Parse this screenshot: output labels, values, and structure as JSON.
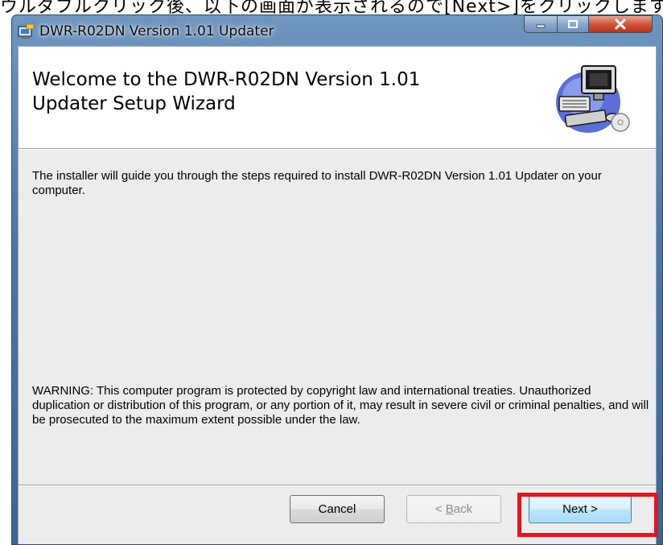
{
  "caption": {
    "text": "ウルダブルクリック後、以下の画面が表示されるので[Next>]をクリックします。"
  },
  "window": {
    "title": "DWR-R02DN Version 1.01 Updater",
    "controls": {
      "minimize": "minimize",
      "maximize": "maximize",
      "close": "close"
    }
  },
  "banner": {
    "title": "Welcome to the DWR-R02DN Version 1.01 Updater Setup Wizard",
    "art_icon": "computer-setup-icon"
  },
  "content": {
    "intro": "The installer will guide you through the steps required to install DWR-R02DN Version 1.01 Updater on your computer.",
    "warning": "WARNING: This computer program is protected by copyright law and international treaties. Unauthorized duplication or distribution of this program, or any portion of it, may result in severe civil or criminal penalties, and will be prosecuted to the maximum extent possible under the law."
  },
  "buttons": {
    "cancel": "Cancel",
    "back_prefix": "< ",
    "back_mnemonic": "B",
    "back_rest": "ack",
    "next": "Next >",
    "back_enabled": false
  },
  "colors": {
    "highlight": "#e8141f",
    "close_button": "#c8432a",
    "titlebar": "#5a82ad"
  }
}
